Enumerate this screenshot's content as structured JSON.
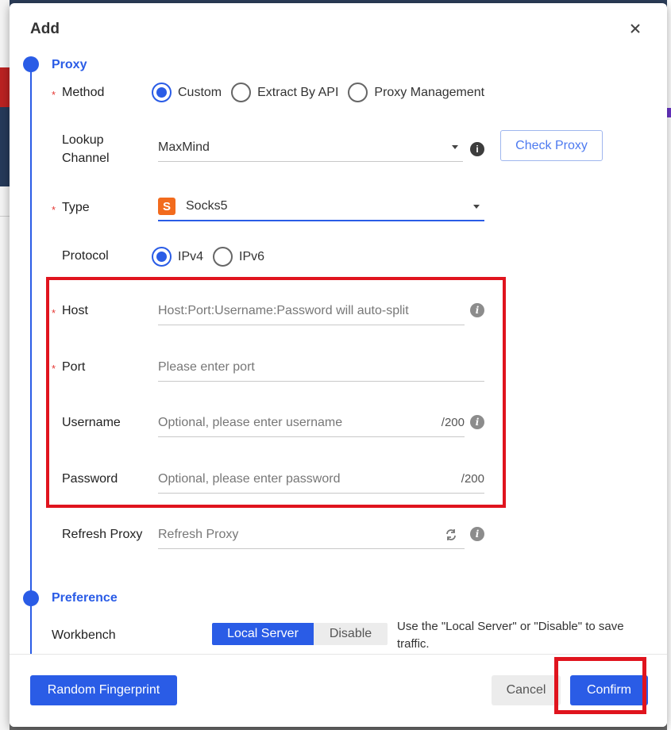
{
  "dialog": {
    "title": "Add"
  },
  "sections": {
    "proxy": "Proxy",
    "preference": "Preference"
  },
  "method": {
    "label": "Method",
    "options": [
      "Custom",
      "Extract By API",
      "Proxy Management"
    ],
    "selected": "Custom"
  },
  "lookup": {
    "label_line1": "Lookup",
    "label_line2": "Channel",
    "value": "MaxMind",
    "check_button": "Check Proxy"
  },
  "type": {
    "label": "Type",
    "badge": "S",
    "value": "Socks5"
  },
  "protocol": {
    "label": "Protocol",
    "options": [
      "IPv4",
      "IPv6"
    ],
    "selected": "IPv4"
  },
  "host": {
    "label": "Host",
    "placeholder": "Host:Port:Username:Password will auto-split"
  },
  "port": {
    "label": "Port",
    "placeholder": "Please enter port"
  },
  "username": {
    "label": "Username",
    "placeholder": "Optional, please enter username",
    "counter": "/200"
  },
  "password": {
    "label": "Password",
    "placeholder": "Optional, please enter password",
    "counter": "/200"
  },
  "refresh": {
    "label": "Refresh Proxy",
    "placeholder": "Refresh Proxy"
  },
  "workbench": {
    "label": "Workbench",
    "options": [
      "Local Server",
      "Disable"
    ],
    "selected": "Local Server",
    "hint": "Use the \"Local Server\" or \"Disable\" to save traffic."
  },
  "footer": {
    "random": "Random Fingerprint",
    "cancel": "Cancel",
    "confirm": "Confirm"
  },
  "icons": {
    "info": "info-icon",
    "close": "close-icon",
    "refresh": "refresh-icon"
  },
  "colors": {
    "accent": "#2a5ce6",
    "highlight": "#e0141e",
    "badge": "#f26b1d"
  }
}
